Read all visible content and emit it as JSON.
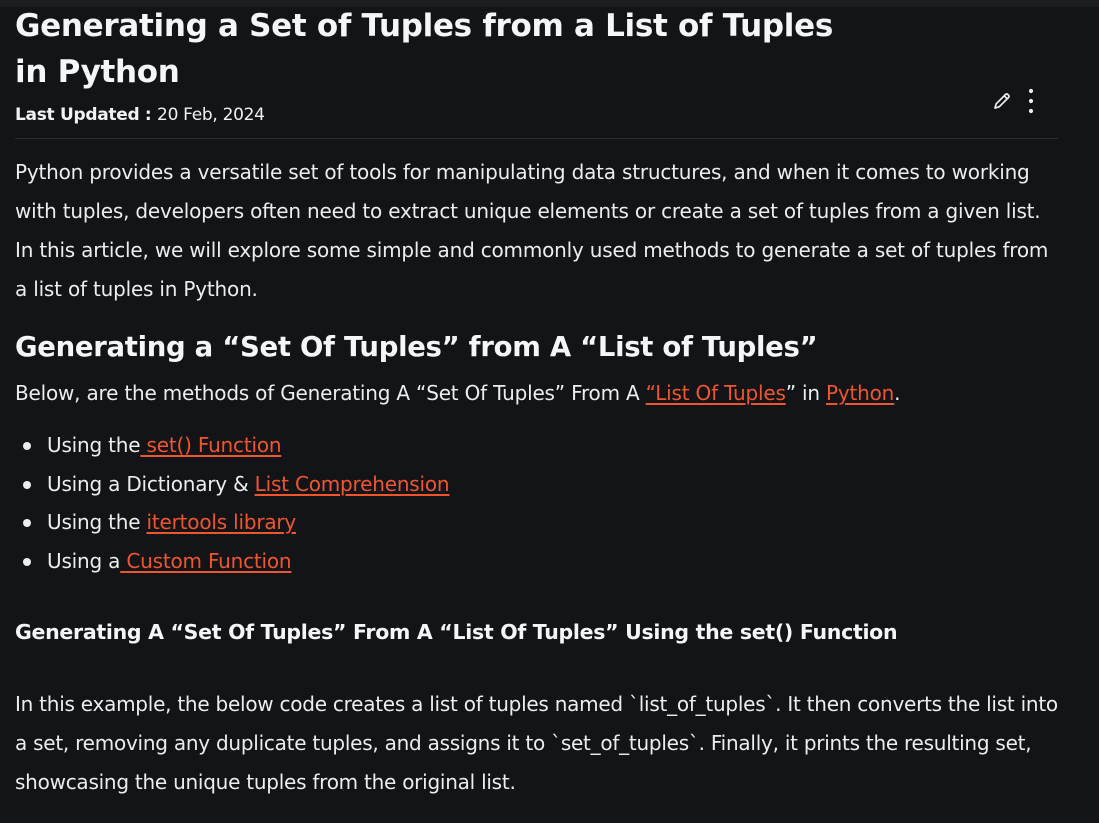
{
  "article": {
    "title": "Generating a Set of Tuples from a List of Tuples in Python",
    "last_updated_label": "Last Updated : ",
    "last_updated_date": "20 Feb, 2024",
    "intro": "Python provides a versatile set of tools for manipulating data structures, and when it comes to working with tuples, developers often need to extract unique elements or create a set of tuples from a given list. In this article, we will explore some simple and commonly used methods to generate a set of tuples from a list of tuples in Python.",
    "section_heading": "Generating a “Set Of Tuples” from A “List of Tuples”",
    "methods_intro": {
      "before": "Below, are the methods of Generating A “Set Of Tuples” From A ",
      "link1": "“List Of Tuples",
      "middle": "” in ",
      "link2": "Python",
      "after": "."
    },
    "methods": [
      {
        "prefix": "Using the",
        "link": " set() Function"
      },
      {
        "prefix": "Using a Dictionary & ",
        "link": "List Comprehension"
      },
      {
        "prefix": "Using the ",
        "link": "itertools library"
      },
      {
        "prefix": "Using a",
        "link": " Custom Function"
      }
    ],
    "subheading": "Generating A “Set Of Tuples” From A “List Of Tuples” Using the set() Function",
    "example_text": "In this example, the below code creates a list of tuples named `list_of_tuples`. It then converts the list into a set, removing any duplicate tuples, and assigns it to `set_of_tuples`. Finally, it prints the resulting set, showcasing the unique tuples from the original list."
  },
  "toolbar": {
    "edit_icon": "pencil-icon",
    "more_icon": "more-vertical-icon"
  },
  "colors": {
    "background": "#131417",
    "text": "#ecedef",
    "link": "#f0562d"
  }
}
